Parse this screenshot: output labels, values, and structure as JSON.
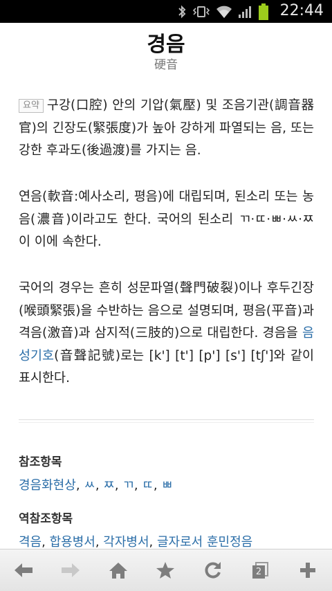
{
  "status_bar": {
    "time": "22:44"
  },
  "entry": {
    "title": "경음",
    "hanja": "硬音",
    "summary_tag": "요약",
    "p1_text": "구강(口腔) 안의 기압(氣壓) 및 조음기관(調音器官)의 긴장도(緊張度)가 높아 강하게 파열되는 음, 또는 강한 후과도(後過渡)를 가지는 음.",
    "p2_text": "연음(軟音:예사소리, 평음)에 대립되며, 된소리 또는 농음(濃音)이라고도 한다. 국어의 된소리 ㄲ·ㄸ·ㅃ·ㅆ·ㅉ이 이에 속한다.",
    "p3_before": "국어의 경우는 흔히 성문파열(聲門破裂)이나 후두긴장(喉頭緊張)을 수반하는 음으로 설명되며, 평음(平音)과 격음(激音)과 삼지적(三肢的)으로 대립한다. 경음을 ",
    "p3_link": "음성기호",
    "p3_after": "(音聲記號)로는 [k'] [t'] [p'] [s'] [tʃ']와 같이 표시한다."
  },
  "references": {
    "heading": "참조항목",
    "links": [
      "경음화현상",
      "ㅆ",
      "ㅉ",
      "ㄲ",
      "ㄸ",
      "ㅃ"
    ]
  },
  "reverse_references": {
    "heading": "역참조항목",
    "links": [
      "격음",
      "합용병서",
      "각자병서",
      "글자로서 훈민정음"
    ]
  },
  "nav": {
    "tabs_count": "2"
  },
  "colors": {
    "link": "#2b6ea8",
    "status_bar": "#000000",
    "battery": "#9ccc1c"
  }
}
